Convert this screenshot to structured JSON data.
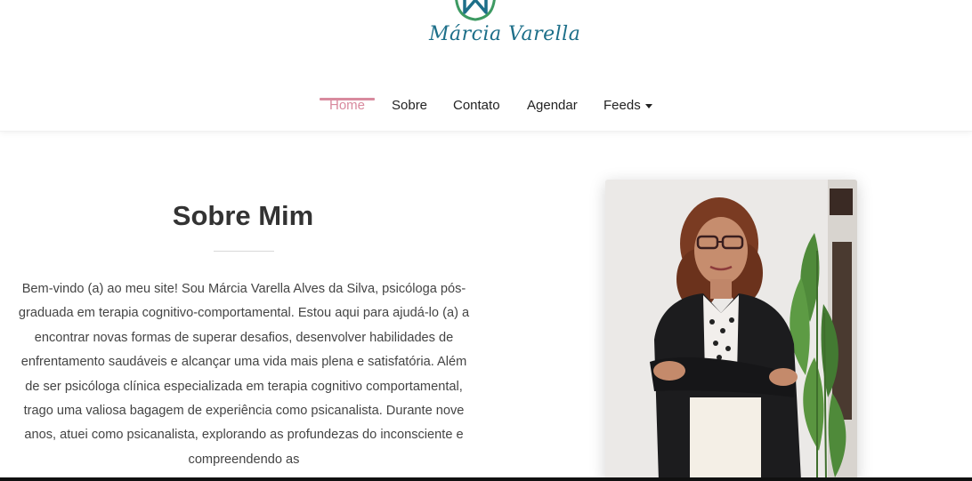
{
  "brand": {
    "name": "Márcia Varella",
    "logo_letter": "M",
    "accent_color": "#1d6f89",
    "leaf_color": "#3d9a62"
  },
  "nav": {
    "items": [
      {
        "label": "Home",
        "active": true
      },
      {
        "label": "Sobre"
      },
      {
        "label": "Contato"
      },
      {
        "label": "Agendar"
      },
      {
        "label": "Feeds",
        "has_dropdown": true
      }
    ],
    "active_color": "#d88a9e"
  },
  "about": {
    "title": "Sobre Mim",
    "paragraph": "Bem-vindo (a) ao meu site! Sou Márcia Varella Alves da Silva, psicóloga pós-graduada em terapia cognitivo-comportamental. Estou aqui para ajudá-lo (a) a encontrar novas formas de superar desafios, desenvolver habilidades de enfrentamento saudáveis e alcançar uma vida mais plena e satisfatória. Além de ser psicóloga clínica especializada em terapia cognitivo comportamental, trago uma valiosa bagagem de experiência como psicanalista. Durante nove anos, atuei como psicanalista, explorando as profundezas do inconsciente e compreendendo as"
  },
  "photo": {
    "subject": "portrait of a woman with glasses in a black blazer, arms crossed, next to a plant"
  }
}
